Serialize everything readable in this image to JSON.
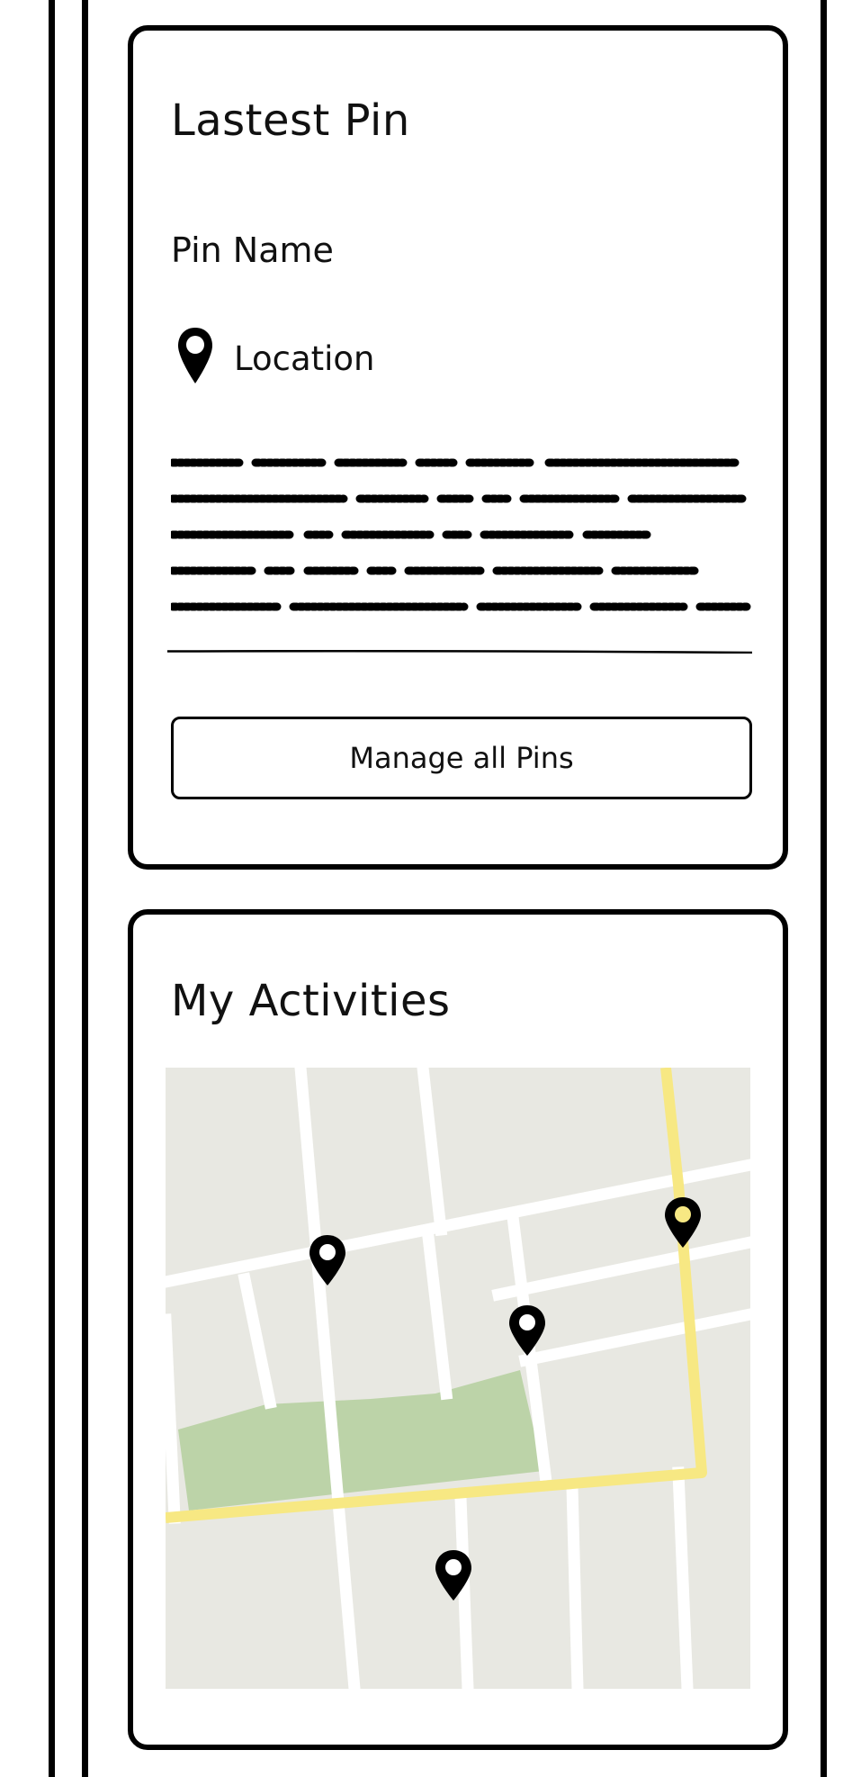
{
  "latest_pin": {
    "title": "Lastest Pin",
    "pin_name": "Pin Name",
    "location_label": "Location",
    "manage_button_label": "Manage all Pins"
  },
  "activities": {
    "title": "My Activities"
  },
  "colors": {
    "frame": "#000000",
    "map_background": "#e8e8e2",
    "map_road": "#ffffff",
    "map_highlight_road": "#f7e883",
    "map_park": "#bcd3a8",
    "pin": "#000000",
    "pin_yellow_dot": "#f7e883"
  },
  "icons": {
    "location": "map-pin-icon"
  }
}
